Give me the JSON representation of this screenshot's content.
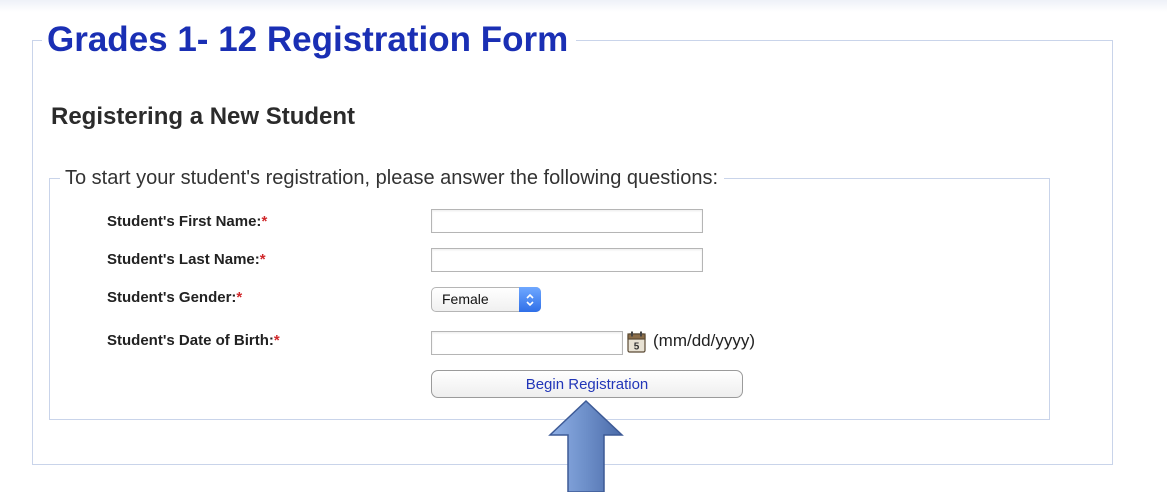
{
  "form": {
    "title": "Grades 1- 12 Registration Form",
    "section_heading": "Registering a New Student",
    "instructions": "To start your student's registration, please answer the following questions:",
    "required_marker": "*"
  },
  "fields": {
    "first_name": {
      "label": "Student's First Name:",
      "value": ""
    },
    "last_name": {
      "label": "Student's Last Name:",
      "value": ""
    },
    "gender": {
      "label": "Student's Gender:",
      "selected": "Female"
    },
    "dob": {
      "label": "Student's Date of Birth:",
      "value": "",
      "format_hint": "(mm/dd/yyyy)",
      "calendar_icon_number": "5"
    }
  },
  "actions": {
    "begin_label": "Begin Registration"
  },
  "icons": {
    "calendar": "calendar-icon",
    "select_arrows": "chevron-updown-icon",
    "callout": "up-arrow-icon"
  },
  "colors": {
    "title": "#1a2fb4",
    "required": "#d0282b",
    "button_text": "#2236b8",
    "select_accent": "#2f6fe8",
    "callout_arrow": "#6d8fc9"
  }
}
